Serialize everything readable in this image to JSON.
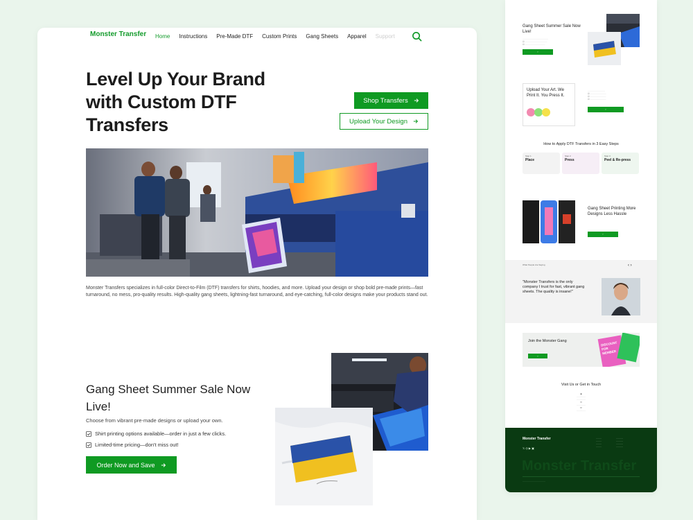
{
  "header": {
    "logo": "Monster Transfer",
    "nav": [
      {
        "label": "Home",
        "state": "active"
      },
      {
        "label": "Instructions",
        "state": ""
      },
      {
        "label": "Pre-Made DTF",
        "state": ""
      },
      {
        "label": "Custom Prints",
        "state": ""
      },
      {
        "label": "Gang Sheets",
        "state": ""
      },
      {
        "label": "Apparel",
        "state": ""
      },
      {
        "label": "Support",
        "state": "faded"
      }
    ],
    "search_icon": "search-icon"
  },
  "hero": {
    "title": "Level Up Your Brand with Custom DTF Transfers",
    "shop_label": "Shop Transfers",
    "upload_label": "Upload Your Design",
    "description": "Monster Transfers specializes in full-color Direct-to-Film (DTF) transfers for shirts, hoodies, and more. Upload your design or shop bold pre-made prints—fast turnaround, no mess, pro-quality results. High-quality gang sheets, lightning-fast turnaround, and eye-catching, full-color designs make your products stand out."
  },
  "sale": {
    "title": "Gang Sheet Summer Sale Now Live!",
    "subtitle": "Choose from vibrant pre-made designs or upload your own.",
    "points": [
      "Shirt printing options available—order in just a few clicks.",
      "Limited-time pricing—don't miss out!"
    ],
    "order_label": "Order Now and Save"
  },
  "side": {
    "sale_title": "Gang Sheet Summer Sale Now Live!",
    "upload_title": "Upload Your Art. We Print It. You Press It.",
    "steps_title": "How to Apply DTF Transfers in 3 Easy Steps",
    "steps": [
      {
        "num": "Step 1",
        "label": "Place"
      },
      {
        "num": "Step 2",
        "label": "Press"
      },
      {
        "num": "Step 3",
        "label": "Peel & Re-press"
      }
    ],
    "gang_title": "Gang Sheet Printing More Designs Less Hassle",
    "testimonials_heading": "What People Are Saying",
    "quote": "\"Monster Transfers is the only company I trust for fast, vibrant gang sheets. The quality is insane!\"",
    "join_title": "Join the Monster Gang",
    "discount_text": "DISCOUNT FOR MEMBER",
    "visit_title": "Visit Us or Get in Touch",
    "footer_logo": "Monster Transfer",
    "footer_big": "Monster Transfer"
  },
  "colors": {
    "brand_green": "#0f9a22",
    "footer_green": "#0a3a12",
    "page_bg": "#eaf5ec"
  }
}
